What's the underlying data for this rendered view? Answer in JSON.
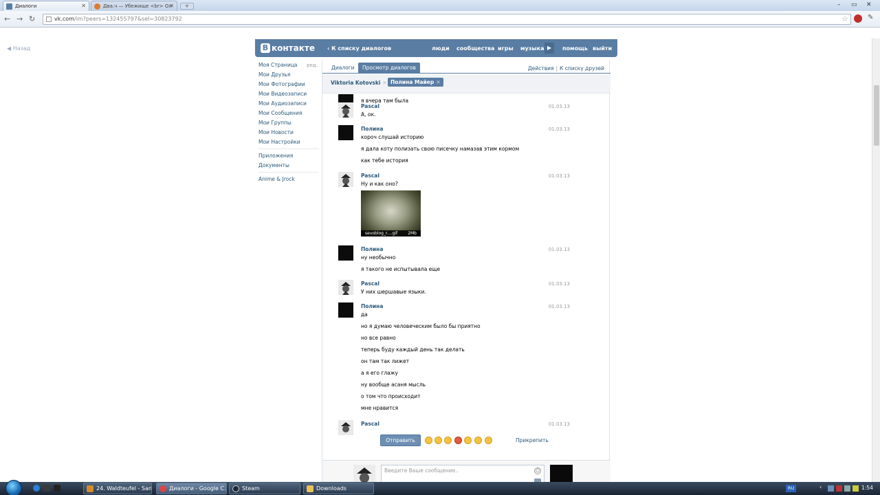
{
  "browser": {
    "tabs": [
      {
        "title": "Диалоги",
        "active": true
      },
      {
        "title": "Два.ч — Убежище <br> Ол",
        "active": false
      }
    ],
    "url_host": "vk.com",
    "url_path": "/im?peers=132455797&sel=30823792",
    "window_controls": [
      "–",
      "▭",
      "✕"
    ]
  },
  "page": {
    "back_link": "Назад",
    "header": {
      "logo_letter": "В",
      "logo_text": "контакте",
      "back_to_dialogs": "К списку диалогов",
      "nav": [
        "люди",
        "сообщества",
        "игры",
        "музыка",
        "помощь",
        "выйти"
      ]
    },
    "left_menu": {
      "items": [
        "Моя Страница",
        "Мои Друзья",
        "Мои Фотографии",
        "Мои Видеозаписи",
        "Мои Аудиозаписи",
        "Мои Сообщения",
        "Мои Группы",
        "Мои Новости",
        "Мои Настройки"
      ],
      "edit": "ред.",
      "extra": [
        "Приложения",
        "Документы"
      ],
      "groups": [
        "Anime & Jrock"
      ]
    },
    "tabs": {
      "dialogs": "Диалоги",
      "view": "Просмотр диалогов",
      "actions": "Действия",
      "friends": "К списку друзей"
    },
    "open_dialogs": [
      "Viktoria Kotovski",
      "Полина Майер"
    ],
    "messages": [
      {
        "author": "",
        "date": "",
        "lines": [
          "я вчера там была"
        ],
        "avatar": "dark"
      },
      {
        "author": "Pascal",
        "date": "01.03.13",
        "lines": [
          "А, ок."
        ],
        "avatar": "pascal"
      },
      {
        "author": "Полина",
        "date": "01.03.13",
        "lines": [
          "короч слушай историю",
          "я дала коту полизать свою писечку намазав этим кормом",
          "как тебе история"
        ],
        "avatar": "dark"
      },
      {
        "author": "Pascal",
        "date": "01.03.13",
        "lines": [
          "Ну и как оно?"
        ],
        "avatar": "pascal",
        "attachment": {
          "name": "sevoblog_r....gif",
          "size": "2Mb"
        }
      },
      {
        "author": "Полина",
        "date": "01.03.13",
        "lines": [
          "ну необычно",
          "я такого не испытывала еще"
        ],
        "avatar": "dark"
      },
      {
        "author": "Pascal",
        "date": "01.03.13",
        "lines": [
          "У них шершавые языки."
        ],
        "avatar": "pascal"
      },
      {
        "author": "Полина",
        "date": "01.03.13",
        "lines": [
          "да",
          "но я думаю человеческим было бы приятно",
          "но все равно",
          "теперь буду каждый день так делать",
          "он там так лижет",
          "а я его глажу",
          "ну вообще асаня мысль",
          "о том что происходит",
          "мне нравится"
        ],
        "avatar": "dark"
      },
      {
        "author": "Pascal",
        "date": "01.03.13",
        "lines": [],
        "avatar": "pascal"
      }
    ],
    "composer": {
      "placeholder": "Введите Ваше сообщение..",
      "send": "Отправить",
      "attach": "Прикрепить"
    }
  },
  "taskbar": {
    "tasks": [
      "24. Waldteufel - San...",
      "Диалоги - Google C...",
      "Steam",
      "Downloads"
    ],
    "lang": "RU",
    "clock": "1:54"
  },
  "colors": {
    "vk_blue": "#597da3",
    "link": "#2b587a"
  }
}
